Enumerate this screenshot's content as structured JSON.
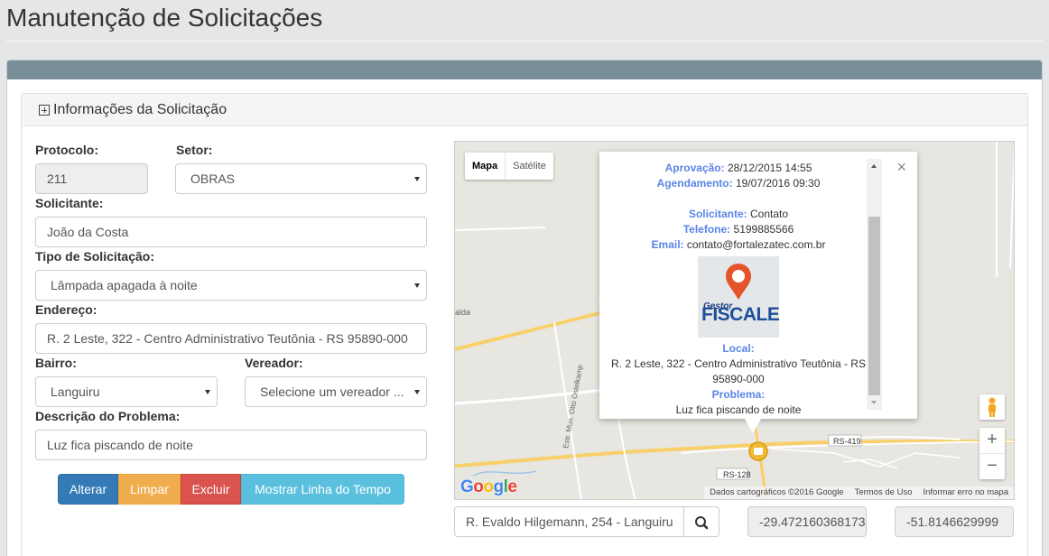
{
  "page": {
    "title": "Manutenção de Solicitações"
  },
  "section": {
    "title": "Informações da Solicitação"
  },
  "form": {
    "protocolo": {
      "label": "Protocolo:",
      "value": "211"
    },
    "setor": {
      "label": "Setor:",
      "value": "OBRAS"
    },
    "solicitante": {
      "label": "Solicitante:",
      "value": "João da Costa"
    },
    "tipo": {
      "label": "Tipo de Solicitação:",
      "value": "Lâmpada apagada à noite"
    },
    "endereco": {
      "label": "Endereço:",
      "value": "R. 2 Leste, 322 - Centro Administrativo Teutônia - RS 95890-000"
    },
    "bairro": {
      "label": "Bairro:",
      "value": "Languiru"
    },
    "vereador": {
      "label": "Vereador:",
      "value": "Selecione um vereador ..."
    },
    "descricao": {
      "label": "Descrição do Problema:",
      "value": "Luz fica piscando de noite"
    }
  },
  "buttons": {
    "alterar": "Alterar",
    "limpar": "Limpar",
    "excluir": "Excluir",
    "timeline": "Mostrar Linha do Tempo"
  },
  "map": {
    "type_map": "Mapa",
    "type_satellite": "Satélite",
    "labels": {
      "rs419": "RS-419",
      "rs128": "RS-128",
      "street": "Estr. Mun. Otto Ostelkamp",
      "place": "alda"
    },
    "attribution": {
      "data": "Dados cartográficos ©2016 Google",
      "terms": "Termos de Uso",
      "report": "Informar erro no mapa"
    },
    "logo": "Google",
    "zoom_in": "+",
    "zoom_out": "−"
  },
  "infowindow": {
    "aprovacao_label": "Aprovação:",
    "aprovacao": "28/12/2015 14:55",
    "agendamento_label": "Agendamento:",
    "agendamento": "19/07/2016 09:30",
    "solicitante_label": "Solicitante:",
    "solicitante": "Contato",
    "telefone_label": "Telefone:",
    "telefone": "5199885566",
    "email_label": "Email:",
    "email": "contato@fortalezatec.com.br",
    "logo_small": "Gestor",
    "logo_word": "FISCALE",
    "local_label": "Local:",
    "local": "R. 2 Leste, 322 - Centro Administrativo Teutônia - RS 95890-000",
    "problema_label": "Problema:",
    "problema": "Luz fica piscando de noite",
    "close": "×"
  },
  "search": {
    "address": "R. Evaldo Hilgemann, 254 - Languiru",
    "lat": "-29.4721603681734",
    "lng": "-51.8146629999"
  },
  "colors": {
    "primary": "#337ab7",
    "warning": "#f0ad4e",
    "danger": "#d9534f",
    "info": "#5bc0de",
    "panel_header": "#788e98"
  }
}
